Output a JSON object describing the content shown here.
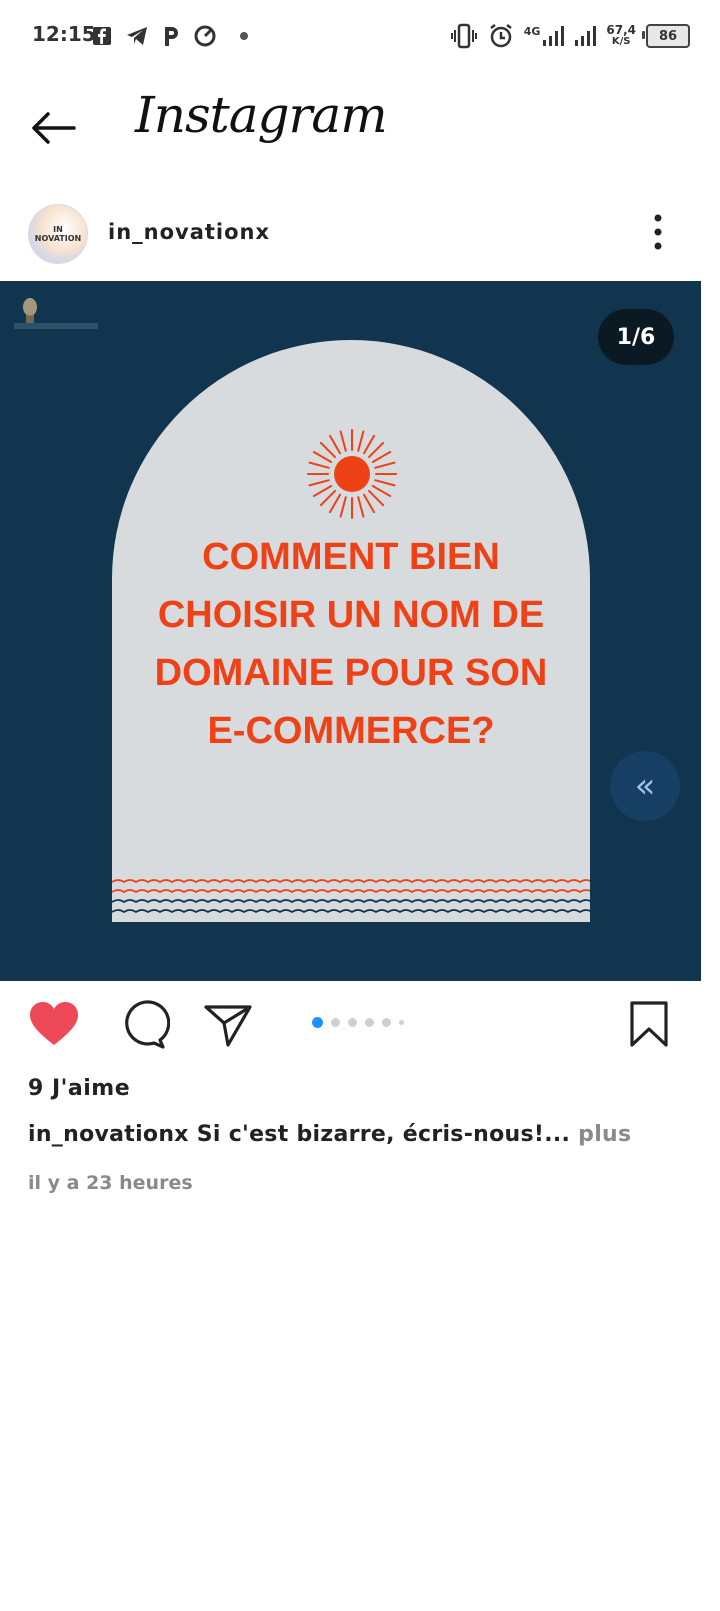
{
  "status_bar": {
    "time": "12:15",
    "left_icons": [
      "facebook-icon",
      "telegram-icon",
      "parking-icon",
      "speed-icon",
      "dot-icon"
    ],
    "network_type": "4G",
    "net_speed_value": "67,4",
    "net_speed_unit": "K/S",
    "battery": "86"
  },
  "header": {
    "title": "Instagram"
  },
  "post": {
    "username": "in_novationx",
    "avatar_text": "IN NOVATION",
    "page_counter": "1/6",
    "headline_lines": [
      "COMMENT BIEN",
      "CHOISIR UN NOM DE",
      "DOMAINE POUR SON",
      "E-COMMERCE?"
    ],
    "carousel": {
      "total": 6,
      "current": 1
    },
    "likes": "9 J'aime",
    "caption_username": "in_novationx",
    "caption_text": "Si c'est bizarre, écris-nous!...",
    "caption_more": "plus",
    "timestamp": "il y a 23 heures"
  },
  "colors": {
    "image_bg": "#12354f",
    "arch_bg": "#d7dbde",
    "headline": "#ef4116",
    "like_red": "#ed4956",
    "active_dot": "#1e90ff"
  }
}
